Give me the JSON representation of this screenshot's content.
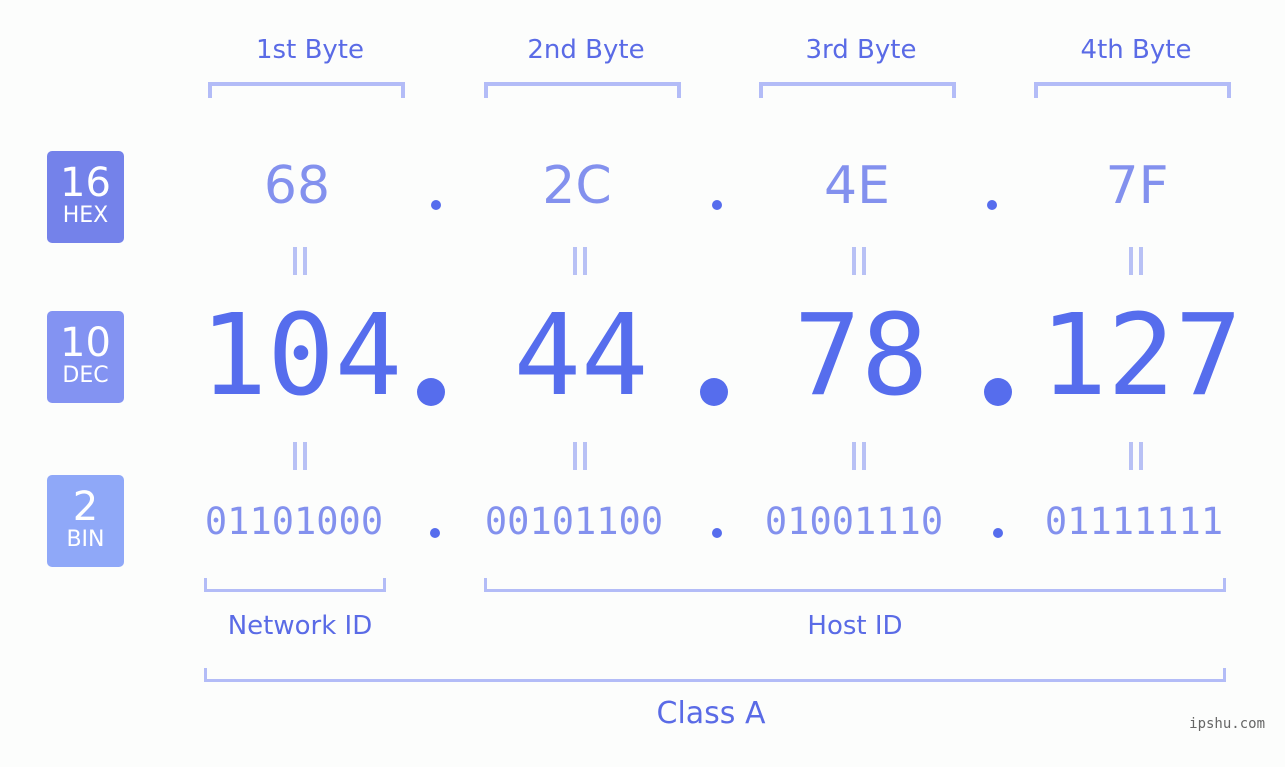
{
  "colors": {
    "hex_badge": "#7482ea",
    "dec_badge": "#8393f2",
    "bin_badge": "#8fa8f8",
    "primary_text": "#566ded",
    "secondary_text": "#8391ee",
    "bracket": "#b3bcf7"
  },
  "badges": [
    {
      "base": "16",
      "name": "HEX"
    },
    {
      "base": "10",
      "name": "DEC"
    },
    {
      "base": "2",
      "name": "BIN"
    }
  ],
  "byte_headers": [
    "1st Byte",
    "2nd Byte",
    "3rd Byte",
    "4th Byte"
  ],
  "hex": [
    "68",
    "2C",
    "4E",
    "7F"
  ],
  "dec": [
    "104",
    "44",
    "78",
    "127"
  ],
  "bin": [
    "01101000",
    "00101100",
    "01001110",
    "01111111"
  ],
  "segments": {
    "network_id": "Network ID",
    "host_id": "Host ID",
    "class": "Class A"
  },
  "watermark": "ipshu.com"
}
